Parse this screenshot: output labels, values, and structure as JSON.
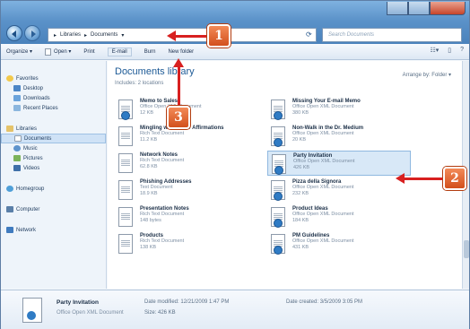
{
  "address": {
    "segments": [
      "Libraries",
      "Documents"
    ]
  },
  "search": {
    "placeholder": "Search Documents"
  },
  "toolbar": {
    "organize": "Organize ▾",
    "open": "Open ▾",
    "print": "Print",
    "email": "E-mail",
    "burn": "Burn",
    "new_folder": "New folder"
  },
  "sidebar": {
    "favorites": "Favorites",
    "favorites_items": [
      "Desktop",
      "Downloads",
      "Recent Places"
    ],
    "libraries": "Libraries",
    "libraries_items": [
      "Documents",
      "Music",
      "Pictures",
      "Videos"
    ],
    "homegroup": "Homegroup",
    "computer": "Computer",
    "network": "Network"
  },
  "main": {
    "title": "Documents library",
    "includes": "Includes: 2 locations",
    "arrange": "Arrange by:  Folder ▾"
  },
  "files": [
    {
      "name": "Memo to Sales",
      "type": "Office Open XML Document",
      "size": "12 KB",
      "kind": "word"
    },
    {
      "name": "Missing Your E-mail Memo",
      "type": "Office Open XML Document",
      "size": "380 KB",
      "kind": "word"
    },
    {
      "name": "Mingling with Letter Affirmations",
      "type": "Rich Text Document",
      "size": "11.2 KB",
      "kind": "text"
    },
    {
      "name": "Non-Walk in the Dr. Medium",
      "type": "Office Open XML Document",
      "size": "20 KB",
      "kind": "word"
    },
    {
      "name": "Network Notes",
      "type": "Rich Text Document",
      "size": "62.8 KB",
      "kind": "text"
    },
    {
      "name": "Party Invitation",
      "type": "Office Open XML Document",
      "size": "426 KB",
      "kind": "word"
    },
    {
      "name": "Phishing Addresses",
      "type": "Text Document",
      "size": "18.9 KB",
      "kind": "text"
    },
    {
      "name": "Pizza della Signora",
      "type": "Office Open XML Document",
      "size": "232 KB",
      "kind": "word"
    },
    {
      "name": "Presentation Notes",
      "type": "Rich Text Document",
      "size": "148 bytes",
      "kind": "text"
    },
    {
      "name": "Product Ideas",
      "type": "Office Open XML Document",
      "size": "184 KB",
      "kind": "word"
    },
    {
      "name": "Products",
      "type": "Rich Text Document",
      "size": "138 KB",
      "kind": "text"
    },
    {
      "name": "PM Guidelines",
      "type": "Office Open XML Document",
      "size": "431 KB",
      "kind": "word"
    }
  ],
  "details": {
    "name": "Party Invitation",
    "type": "Office Open XML Document",
    "modified": "Date modified: 12/21/2009 1:47 PM",
    "size": "Size: 426 KB",
    "created": "Date created: 3/5/2009 3:05 PM"
  },
  "callouts": [
    "1",
    "2",
    "3"
  ],
  "colors": {
    "callout": "#e06a33",
    "arrow": "#d82020",
    "title": "#1d5a96"
  }
}
